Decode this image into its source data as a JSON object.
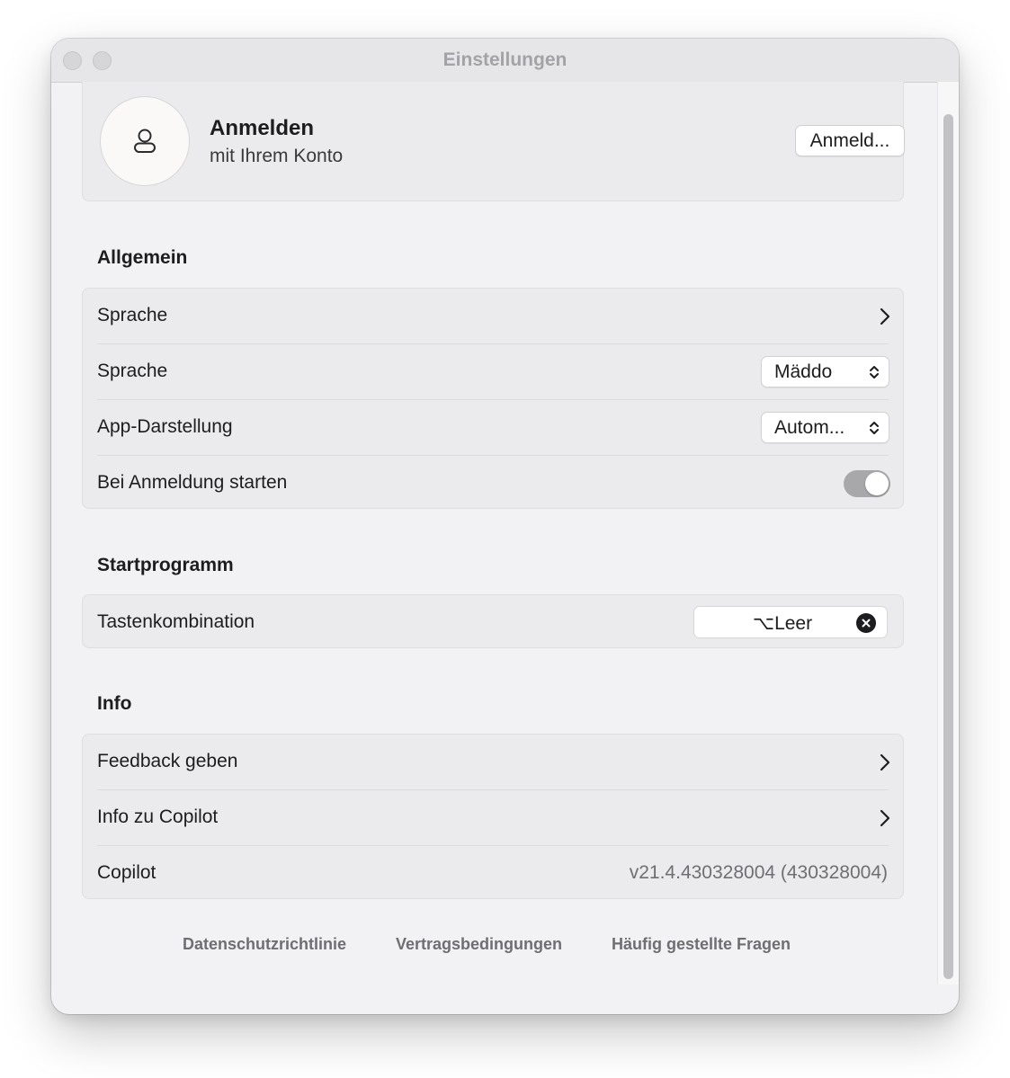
{
  "window": {
    "title": "Einstellungen"
  },
  "account": {
    "title": "Anmelden",
    "subtitle": "mit Ihrem Konto",
    "button_label": "Anmeld..."
  },
  "general": {
    "heading": "Allgemein",
    "rows": [
      {
        "label": "Sprache",
        "control": "chevron"
      },
      {
        "label": "Sprache",
        "control": "select",
        "value": "Mäddo"
      },
      {
        "label": "App-Darstellung",
        "control": "select",
        "value": "Autom..."
      },
      {
        "label": "Bei Anmeldung starten",
        "control": "toggle",
        "on": true
      }
    ]
  },
  "launcher": {
    "heading": "Startprogramm",
    "rows": [
      {
        "label": "Tastenkombination",
        "control": "shortcut",
        "value": "⌥Leer"
      }
    ]
  },
  "info": {
    "heading": "Info",
    "rows": [
      {
        "label": "Feedback geben",
        "control": "chevron"
      },
      {
        "label": "Info zu Copilot",
        "control": "chevron"
      },
      {
        "label": "Copilot",
        "control": "text",
        "value": "v21.4.430328004 (430328004)"
      }
    ]
  },
  "footer": {
    "privacy": "Datenschutzrichtlinie",
    "terms": "Vertragsbedingungen",
    "faq": "Häufig gestellte Fragen"
  },
  "icons": {
    "avatar": "person-icon",
    "chevron": "chevron-right-icon",
    "select": "up-down-chevron-icon",
    "clear": "clear-x-icon"
  }
}
